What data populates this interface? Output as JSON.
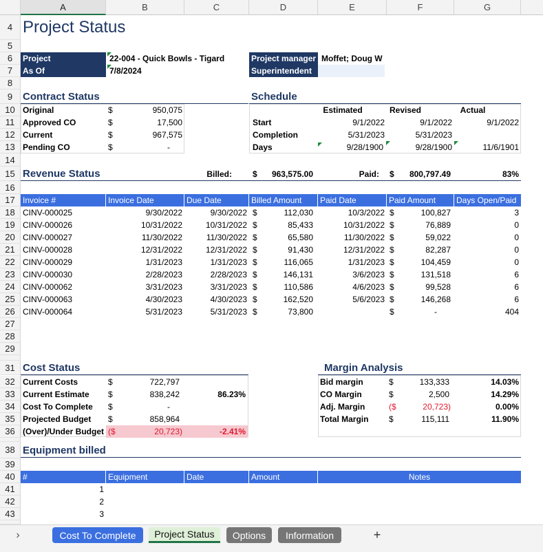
{
  "columns": [
    "A",
    "B",
    "C",
    "D",
    "E",
    "F",
    "G"
  ],
  "title": "Project Status",
  "project": {
    "label": "Project",
    "value": "22-004 - Quick Bowls - Tigard",
    "as_of_label": "As Of",
    "as_of": "7/8/2024",
    "pm_label": "Project manager",
    "pm": "Moffet; Doug W",
    "super_label": "Superintendent",
    "super": ""
  },
  "contract": {
    "heading": "Contract Status",
    "rows": [
      {
        "label": "Original",
        "cur": "$",
        "value": "950,075"
      },
      {
        "label": "Approved CO",
        "cur": "$",
        "value": "17,500"
      },
      {
        "label": "Current",
        "cur": "$",
        "value": "967,575"
      },
      {
        "label": "Pending CO",
        "cur": "$",
        "value": "-"
      }
    ]
  },
  "schedule": {
    "heading": "Schedule",
    "col_estimated": "Estimated",
    "col_revised": "Revised",
    "col_actual": "Actual",
    "rows": [
      {
        "label": "Start",
        "est": "9/1/2022",
        "rev": "9/1/2022",
        "act": "9/1/2022"
      },
      {
        "label": "Completion",
        "est": "5/31/2023",
        "rev": "5/31/2023",
        "act": ""
      },
      {
        "label": "Days",
        "est": "9/28/1900",
        "rev": "9/28/1900",
        "act": "11/6/1901"
      }
    ]
  },
  "revenue": {
    "heading": "Revenue Status",
    "billed_label": "Billed:",
    "billed_cur": "$",
    "billed": "963,575.00",
    "paid_label": "Paid:",
    "paid_cur": "$",
    "paid": "800,797.49",
    "pct": "83%",
    "headers": [
      "Invoice #",
      "Invoice Date",
      "Due Date",
      "Billed Amount",
      "Paid Date",
      "Paid Amount",
      "Days Open/Paid"
    ],
    "rows": [
      {
        "inv": "CINV-000025",
        "idate": "9/30/2022",
        "due": "9/30/2022",
        "bcur": "$",
        "billed": "112,030",
        "pdate": "10/3/2022",
        "pcur": "$",
        "paid": "100,827",
        "days": "3"
      },
      {
        "inv": "CINV-000026",
        "idate": "10/31/2022",
        "due": "10/31/2022",
        "bcur": "$",
        "billed": "85,433",
        "pdate": "10/31/2022",
        "pcur": "$",
        "paid": "76,889",
        "days": "0"
      },
      {
        "inv": "CINV-000027",
        "idate": "11/30/2022",
        "due": "11/30/2022",
        "bcur": "$",
        "billed": "65,580",
        "pdate": "11/30/2022",
        "pcur": "$",
        "paid": "59,022",
        "days": "0"
      },
      {
        "inv": "CINV-000028",
        "idate": "12/31/2022",
        "due": "12/31/2022",
        "bcur": "$",
        "billed": "91,430",
        "pdate": "12/31/2022",
        "pcur": "$",
        "paid": "82,287",
        "days": "0"
      },
      {
        "inv": "CINV-000029",
        "idate": "1/31/2023",
        "due": "1/31/2023",
        "bcur": "$",
        "billed": "116,065",
        "pdate": "1/31/2023",
        "pcur": "$",
        "paid": "104,459",
        "days": "0"
      },
      {
        "inv": "CINV-000030",
        "idate": "2/28/2023",
        "due": "2/28/2023",
        "bcur": "$",
        "billed": "146,131",
        "pdate": "3/6/2023",
        "pcur": "$",
        "paid": "131,518",
        "days": "6"
      },
      {
        "inv": "CINV-000062",
        "idate": "3/31/2023",
        "due": "3/31/2023",
        "bcur": "$",
        "billed": "110,586",
        "pdate": "4/6/2023",
        "pcur": "$",
        "paid": "99,528",
        "days": "6"
      },
      {
        "inv": "CINV-000063",
        "idate": "4/30/2023",
        "due": "4/30/2023",
        "bcur": "$",
        "billed": "162,520",
        "pdate": "5/6/2023",
        "pcur": "$",
        "paid": "146,268",
        "days": "6"
      },
      {
        "inv": "CINV-000064",
        "idate": "5/31/2023",
        "due": "5/31/2023",
        "bcur": "$",
        "billed": "73,800",
        "pdate": "",
        "pcur": "$",
        "paid": "-",
        "days": "404"
      }
    ]
  },
  "cost": {
    "heading": "Cost Status",
    "rows": [
      {
        "label": "Current Costs",
        "cur": "$",
        "value": "722,797",
        "pct": ""
      },
      {
        "label": "Current Estimate",
        "cur": "$",
        "value": "838,242",
        "pct": "86.23%"
      },
      {
        "label": "Cost To Complete",
        "cur": "$",
        "value": "-",
        "pct": ""
      },
      {
        "label": "Projected Budget",
        "cur": "$",
        "value": "858,964",
        "pct": ""
      },
      {
        "label": "(Over)/Under Budget",
        "cur": "($",
        "value": "20,723)",
        "pct": "-2.41%"
      }
    ]
  },
  "margin": {
    "heading": "Margin Analysis",
    "rows": [
      {
        "label": "Bid margin",
        "cur": "$",
        "value": "133,333",
        "pct": "14.03%"
      },
      {
        "label": "CO Margin",
        "cur": "$",
        "value": "2,500",
        "pct": "14.29%"
      },
      {
        "label": "Adj. Margin",
        "cur": "($",
        "value": "20,723)",
        "pct": "0.00%"
      },
      {
        "label": "Total Margin",
        "cur": "$",
        "value": "115,111",
        "pct": "11.90%"
      }
    ]
  },
  "equipment": {
    "heading": "Equipment billed",
    "headers": [
      "#",
      "Equipment",
      "Date",
      "Amount",
      "Notes"
    ],
    "rows": [
      "1",
      "2",
      "3"
    ]
  },
  "tabs": {
    "cost_to_complete": "Cost To Complete",
    "project_status": "Project Status",
    "options": "Options",
    "information": "Information",
    "add": "+",
    "nav": "›"
  }
}
